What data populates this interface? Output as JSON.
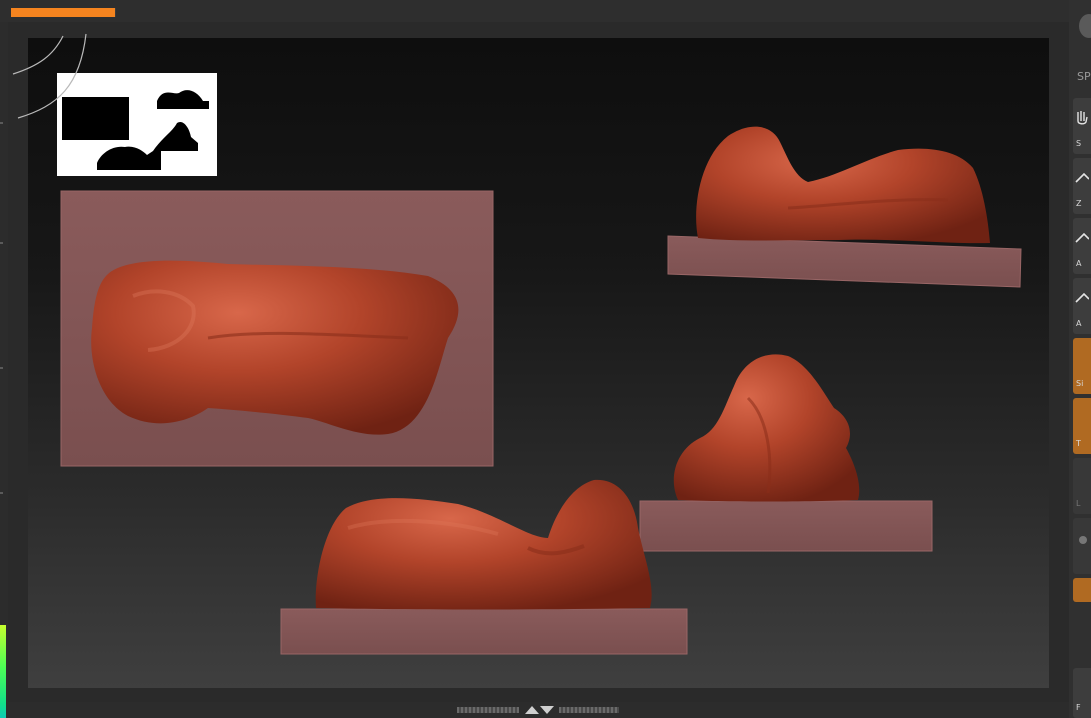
{
  "app": {
    "progress_fraction": 0.99,
    "accent_color": "#f5841f"
  },
  "viewport": {
    "background_top": "#0e0e0e",
    "background_bottom": "#3f3f3f",
    "model_color": "#a83a22",
    "base_plate_color": "#7d5252"
  },
  "icons": {
    "navigator": "navigator-thumbnail",
    "rotate_widget": "arc-icon",
    "split_arrows": "up-down-arrows-icon"
  },
  "right_shelf": {
    "title": "SP",
    "buttons": [
      {
        "label": "S"
      },
      {
        "label": "Z"
      },
      {
        "label": "A"
      },
      {
        "label": "A"
      },
      {
        "label": "Si"
      },
      {
        "label": "T"
      },
      {
        "label": "L"
      },
      {
        "label": ""
      }
    ],
    "bottom_label": "F"
  }
}
